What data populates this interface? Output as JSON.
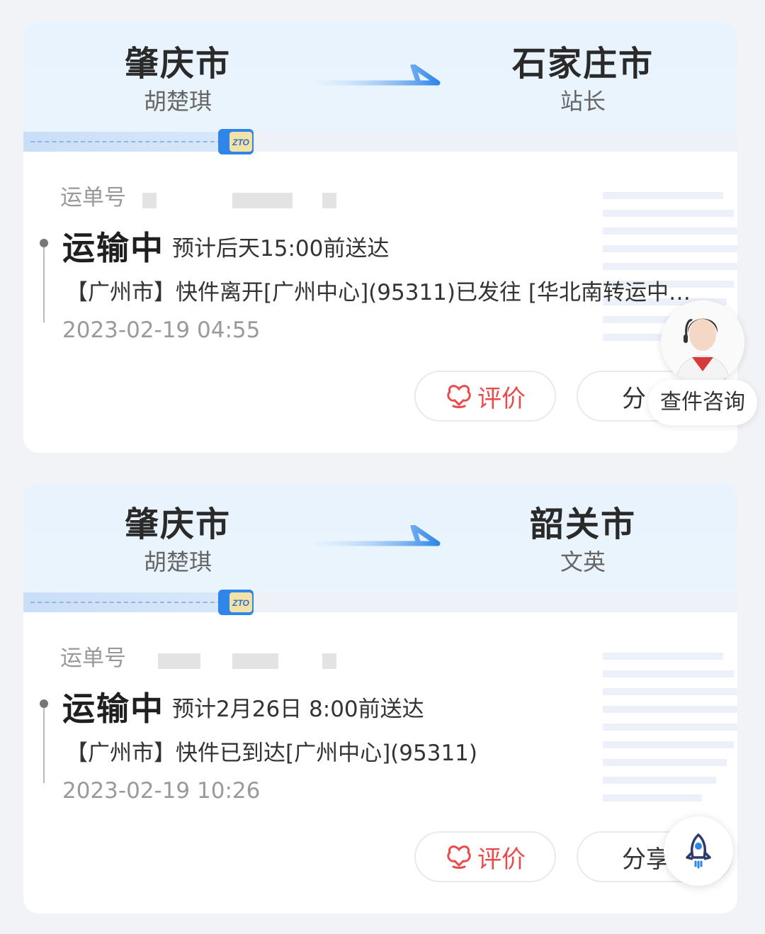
{
  "parcels": [
    {
      "from_city": "肇庆市",
      "from_person": "胡楚琪",
      "to_city": "石家庄市",
      "to_person": "站长",
      "carrier_badge": "ZTO",
      "waybill_label": "运单号",
      "status": "运输中",
      "eta": "预计后天15:00前送达",
      "latest_event": "【广州市】快件离开[广州中心](95311)已发往 [华北南转运中…",
      "event_time": "2023-02-19 04:55",
      "rate_label": "评价",
      "share_label": "分"
    },
    {
      "from_city": "肇庆市",
      "from_person": "胡楚琪",
      "to_city": "韶关市",
      "to_person": "文英",
      "carrier_badge": "ZTO",
      "waybill_label": "运单号",
      "status": "运输中",
      "eta": "预计2月26日 8:00前送达",
      "latest_event": "【广州市】快件已到达[广州中心](95311)",
      "event_time": "2023-02-19 10:26",
      "rate_label": "评价",
      "share_label": "分享"
    }
  ],
  "floating": {
    "consult_label": "查件咨询",
    "rocket_icon": "rocket-icon"
  },
  "colors": {
    "accent_blue": "#2f86e8",
    "rate_red": "#e94b4b",
    "header_bg": "#e9f3fd"
  }
}
